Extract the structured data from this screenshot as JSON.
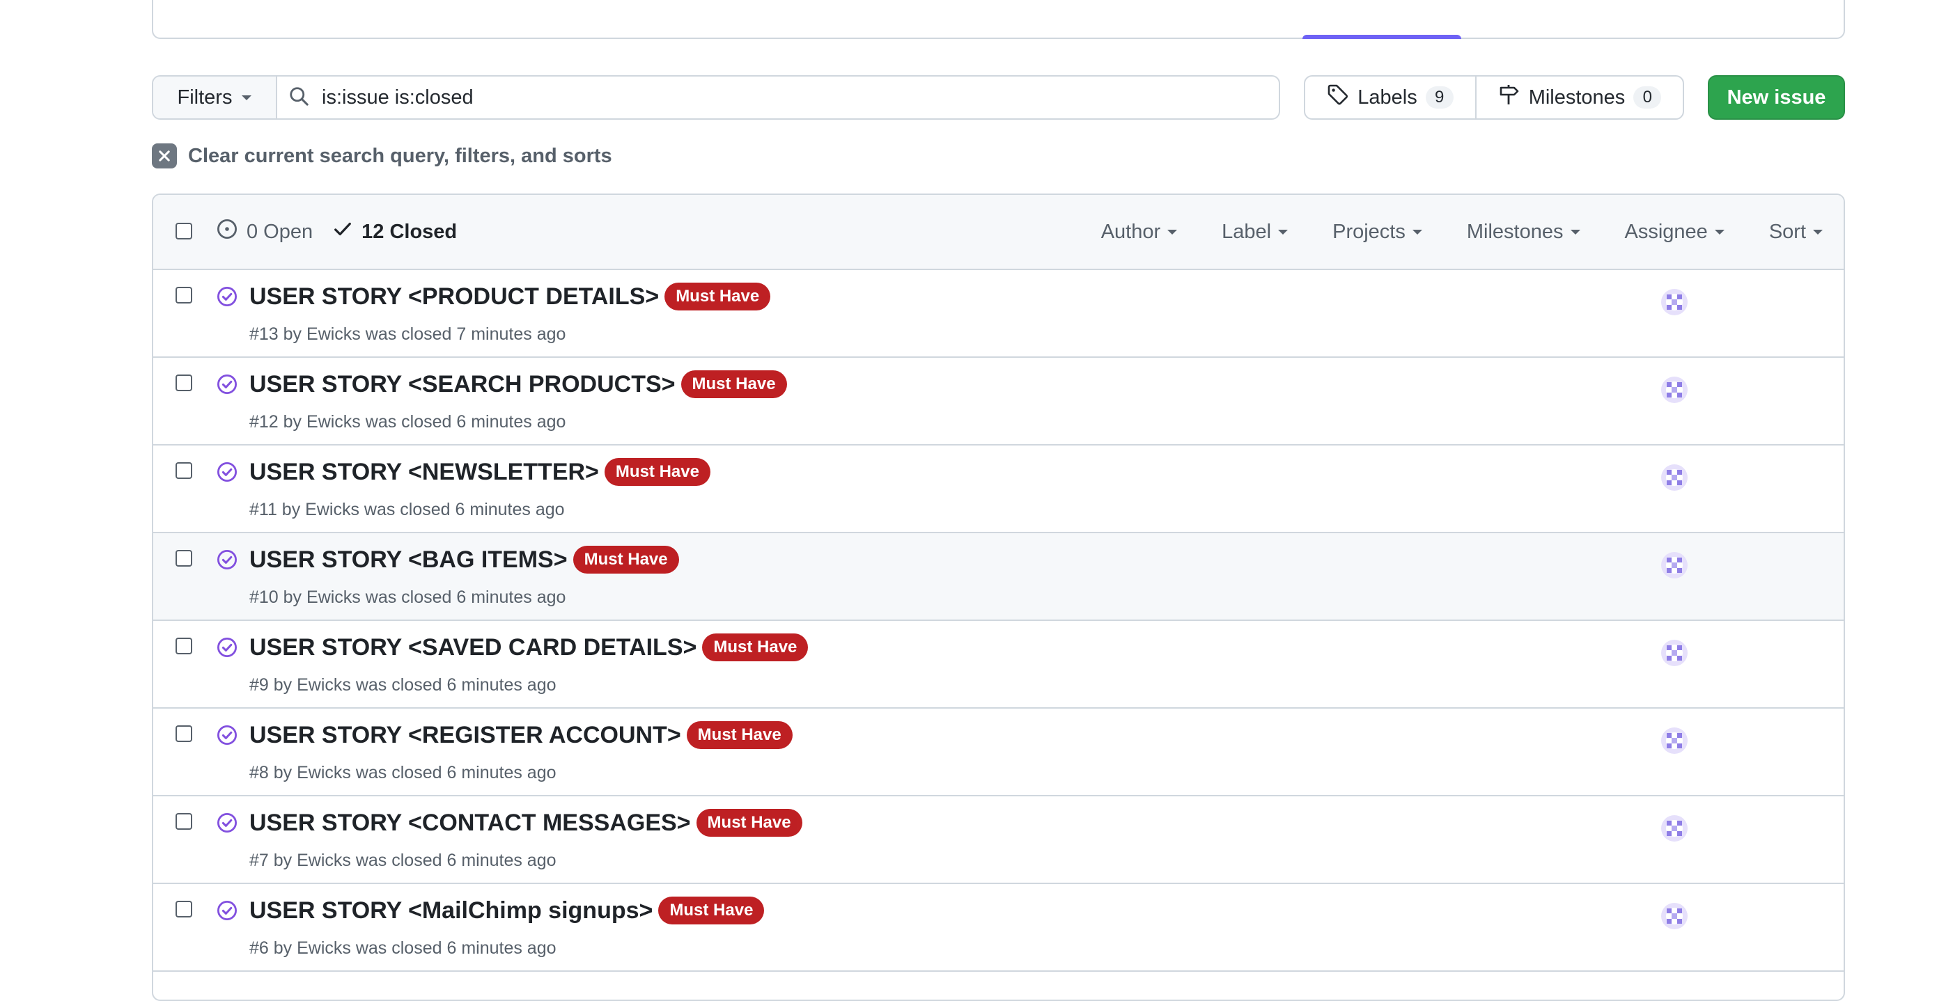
{
  "toolbar": {
    "filters_label": "Filters",
    "search_value": "is:issue is:closed",
    "labels_label": "Labels",
    "labels_count": "9",
    "milestones_label": "Milestones",
    "milestones_count": "0",
    "new_issue_label": "New issue"
  },
  "clear_query": "Clear current search query, filters, and sorts",
  "header": {
    "open_count": "0 Open",
    "closed_count": "12 Closed",
    "menus": [
      "Author",
      "Label",
      "Projects",
      "Milestones",
      "Assignee",
      "Sort"
    ]
  },
  "issues": [
    {
      "title": "USER STORY <PRODUCT DETAILS>",
      "label": "Must Have",
      "meta_pre": "#13 by ",
      "author": "Ewicks",
      "meta_post": " was closed 7 minutes ago"
    },
    {
      "title": "USER STORY <SEARCH PRODUCTS>",
      "label": "Must Have",
      "meta_pre": "#12 by ",
      "author": "Ewicks",
      "meta_post": " was closed 6 minutes ago"
    },
    {
      "title": "USER STORY <NEWSLETTER>",
      "label": "Must Have",
      "meta_pre": "#11 by ",
      "author": "Ewicks",
      "meta_post": " was closed 6 minutes ago"
    },
    {
      "title": "USER STORY <BAG ITEMS>",
      "label": "Must Have",
      "meta_pre": "#10 by ",
      "author": "Ewicks",
      "meta_post": " was closed 6 minutes ago"
    },
    {
      "title": "USER STORY <SAVED CARD DETAILS>",
      "label": "Must Have",
      "meta_pre": "#9 by ",
      "author": "Ewicks",
      "meta_post": " was closed 6 minutes ago"
    },
    {
      "title": "USER STORY <REGISTER ACCOUNT>",
      "label": "Must Have",
      "meta_pre": "#8 by ",
      "author": "Ewicks",
      "meta_post": " was closed 6 minutes ago"
    },
    {
      "title": "USER STORY <CONTACT MESSAGES>",
      "label": "Must Have",
      "meta_pre": "#7 by ",
      "author": "Ewicks",
      "meta_post": " was closed 6 minutes ago"
    },
    {
      "title": "USER STORY <MailChimp signups>",
      "label": "Must Have",
      "meta_pre": "#6 by ",
      "author": "Ewicks",
      "meta_post": " was closed 6 minutes ago"
    }
  ],
  "colors": {
    "label_bg": "#b60205",
    "closed_icon": "#8250df",
    "primary_button": "#2da44e"
  }
}
